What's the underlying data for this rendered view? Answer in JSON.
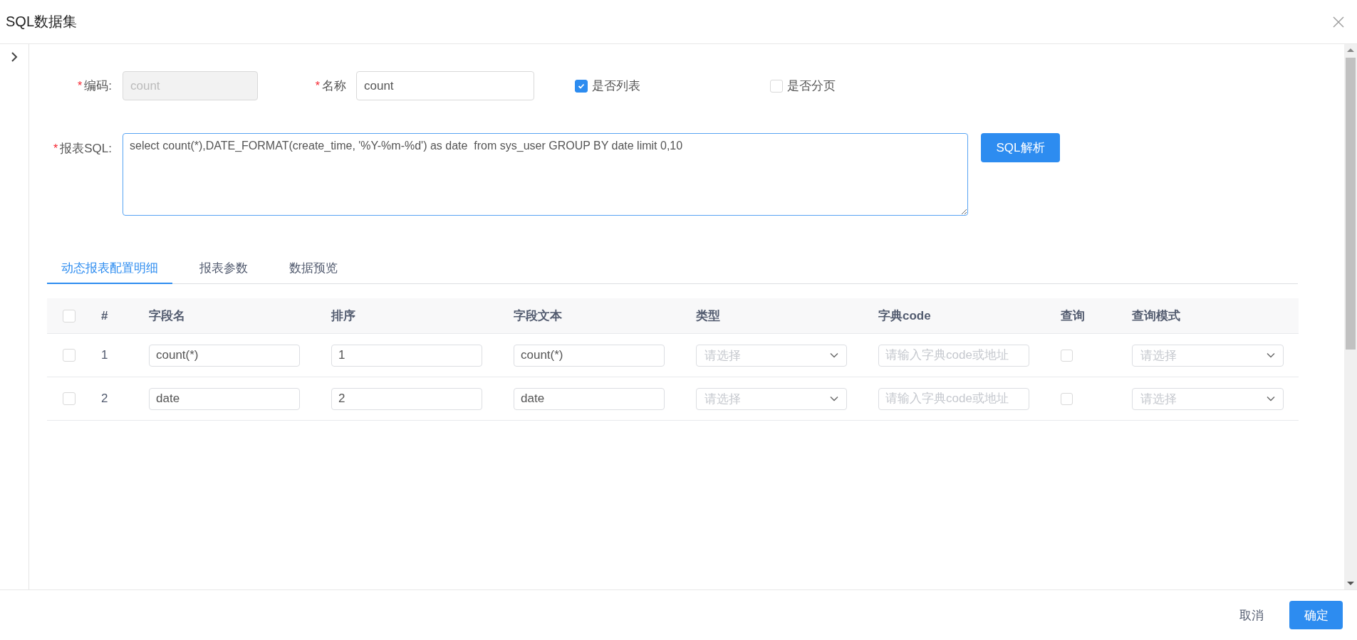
{
  "window": {
    "title": "SQL数据集"
  },
  "form": {
    "code": {
      "required_mark": "*",
      "label": "编码:",
      "value": "count",
      "disabled": true
    },
    "name": {
      "required_mark": "*",
      "label": "名称",
      "value": "count"
    },
    "checkboxes": [
      {
        "label": "是否列表",
        "checked": true
      },
      {
        "label": "是否分页",
        "checked": false
      }
    ],
    "sql": {
      "required_mark": "*",
      "label": "报表SQL:",
      "value": "select count(*),DATE_FORMAT(create_time, '%Y-%m-%d') as date  from sys_user GROUP BY date limit 0,10"
    },
    "parse_button": "SQL解析"
  },
  "tabs": [
    {
      "label": "动态报表配置明细",
      "selected": true
    },
    {
      "label": "报表参数",
      "selected": false
    },
    {
      "label": "数据预览",
      "selected": false
    }
  ],
  "table": {
    "header_checked": false,
    "columns": [
      "#",
      "字段名",
      "排序",
      "字段文本",
      "类型",
      "字典code",
      "查询",
      "查询模式"
    ],
    "rows": [
      {
        "checked": false,
        "index": "1",
        "field_name": "count(*)",
        "order": "1",
        "field_text": "count(*)",
        "type_placeholder": "请选择",
        "dict_placeholder": "请输入字典code或地址",
        "query": false,
        "query_mode_placeholder": "请选择"
      },
      {
        "checked": false,
        "index": "2",
        "field_name": "date",
        "order": "2",
        "field_text": "date",
        "type_placeholder": "请选择",
        "dict_placeholder": "请输入字典code或地址",
        "query": false,
        "query_mode_placeholder": "请选择"
      }
    ]
  },
  "footer": {
    "cancel": "取消",
    "ok": "确定"
  }
}
